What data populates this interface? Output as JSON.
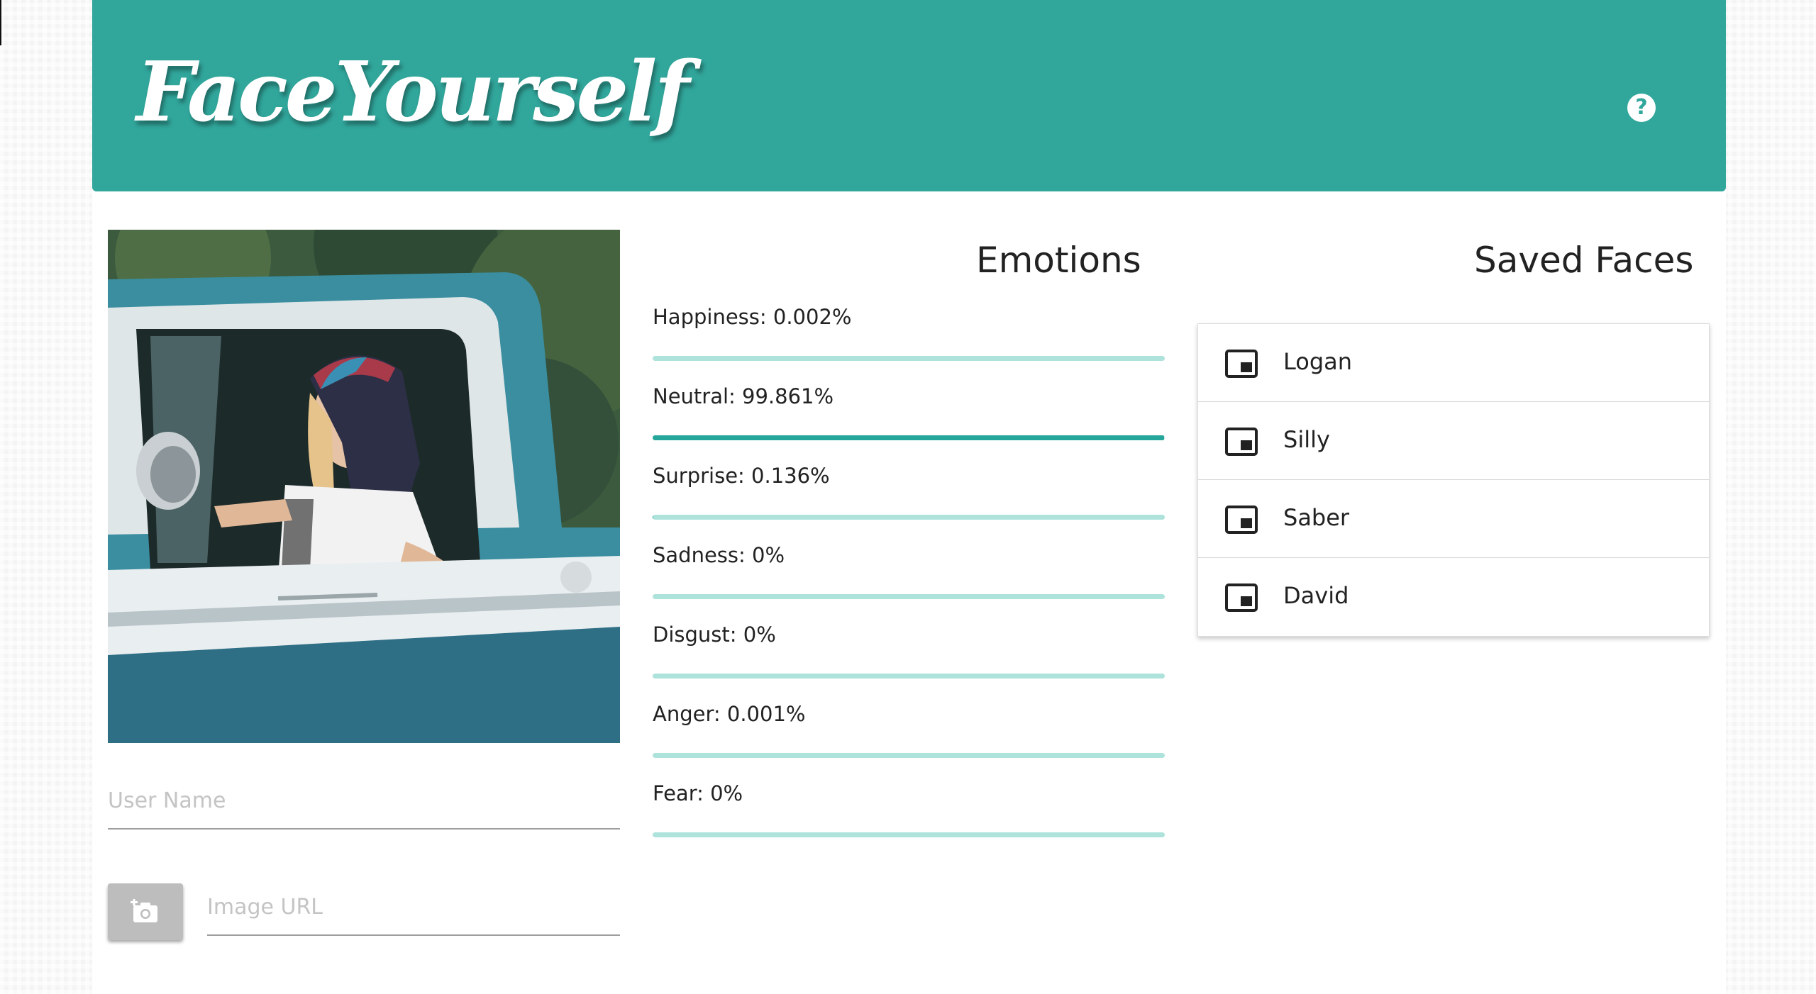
{
  "header": {
    "logo_text": "FaceYourself",
    "help_icon": "help-circle-icon",
    "color": "#31a69b"
  },
  "form": {
    "username_placeholder": "User Name",
    "image_url_placeholder": "Image URL",
    "camera_icon": "add-a-photo-icon"
  },
  "emotions": {
    "title": "Emotions",
    "track_color": "#aee3dc",
    "fill_color": "#26a69a",
    "items": [
      {
        "label": "Happiness: 0.002%",
        "percent": 0.002
      },
      {
        "label": "Neutral: 99.861%",
        "percent": 99.861
      },
      {
        "label": "Surprise: 0.136%",
        "percent": 0.136
      },
      {
        "label": "Sadness: 0%",
        "percent": 0
      },
      {
        "label": "Disgust: 0%",
        "percent": 0
      },
      {
        "label": "Anger: 0.001%",
        "percent": 0.001
      },
      {
        "label": "Fear: 0%",
        "percent": 0
      }
    ]
  },
  "saved_faces": {
    "title": "Saved Faces",
    "item_icon": "picture-in-picture-icon",
    "items": [
      {
        "name": "Logan"
      },
      {
        "name": "Silly"
      },
      {
        "name": "Saber"
      },
      {
        "name": "David"
      }
    ]
  }
}
